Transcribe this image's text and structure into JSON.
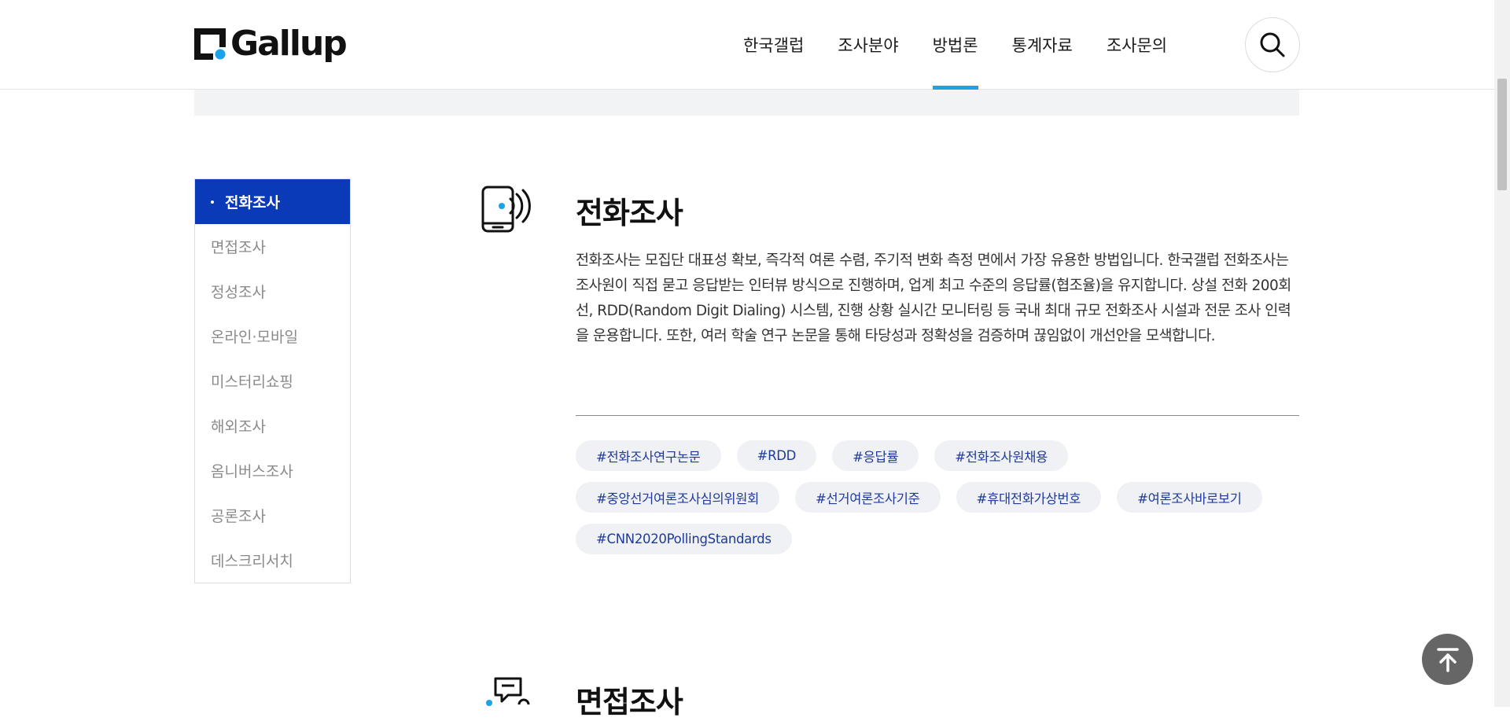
{
  "header": {
    "logo_text": "Gallup",
    "nav": [
      {
        "label": "한국갤럽",
        "active": false
      },
      {
        "label": "조사분야",
        "active": false
      },
      {
        "label": "방법론",
        "active": true
      },
      {
        "label": "통계자료",
        "active": false
      },
      {
        "label": "조사문의",
        "active": false
      }
    ],
    "search_icon": "search-icon"
  },
  "sidebar": {
    "items": [
      {
        "label": "전화조사",
        "active": true
      },
      {
        "label": "면접조사",
        "active": false
      },
      {
        "label": "정성조사",
        "active": false
      },
      {
        "label": "온라인·모바일",
        "active": false
      },
      {
        "label": "미스터리쇼핑",
        "active": false
      },
      {
        "label": "해외조사",
        "active": false
      },
      {
        "label": "옴니버스조사",
        "active": false
      },
      {
        "label": "공론조사",
        "active": false
      },
      {
        "label": "데스크리서치",
        "active": false
      }
    ]
  },
  "section": {
    "title": "전화조사",
    "icon": "phone-call-icon",
    "description": "전화조사는 모집단 대표성 확보, 즉각적 여론 수렴, 주기적 변화 측정 면에서 가장 유용한 방법입니다. 한국갤럽 전화조사는 조사원이 직접 묻고 응답받는 인터뷰 방식으로 진행하며, 업계 최고 수준의 응답률(협조율)을 유지합니다. 상설 전화 200회선, RDD(Random Digit Dialing) 시스템, 진행 상황 실시간 모니터링 등 국내 최대 규모 전화조사 시설과 전문 조사 인력을 운용합니다. 또한, 여러 학술 연구 논문을 통해 타당성과 정확성을 검증하며 끊임없이 개선안을 모색합니다.",
    "tags": [
      [
        "#전화조사연구논문",
        "#RDD",
        "#응답률",
        "#전화조사원채용"
      ],
      [
        "#중앙선거여론조사심의위원회",
        "#선거여론조사기준",
        "#휴대전화가상번호",
        "#여론조사바로보기"
      ],
      [
        "#CNN2020PollingStandards"
      ]
    ]
  },
  "section2": {
    "title": "면접조사",
    "icon": "interview-chat-icon"
  },
  "colors": {
    "brand_blue": "#0a3ab7",
    "accent": "#1aa3e8",
    "tag_text": "#1e3a9b"
  }
}
